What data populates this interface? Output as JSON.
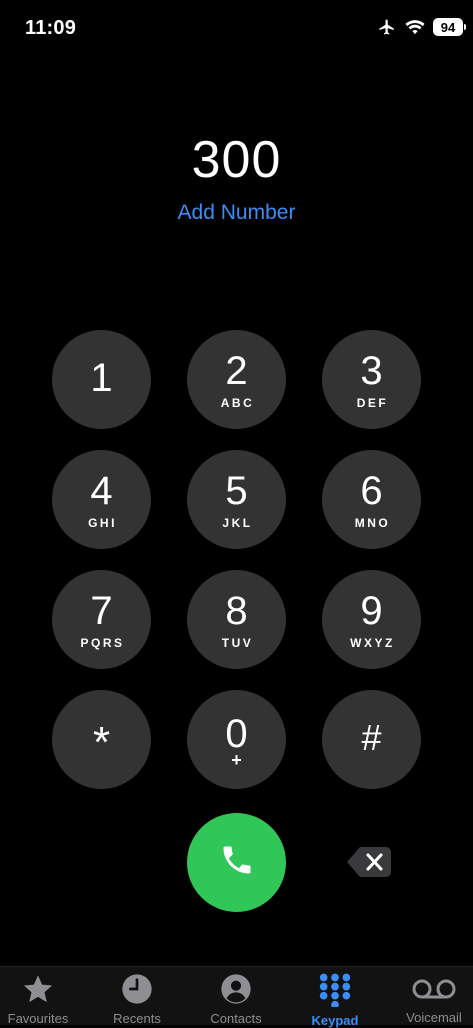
{
  "status_bar": {
    "time": "11:09",
    "battery": "94",
    "icons": [
      "airplane-icon",
      "wifi-icon",
      "battery-icon"
    ]
  },
  "dialer": {
    "number": "300",
    "add_number_label": "Add Number"
  },
  "keypad": {
    "keys": [
      {
        "digit": "1",
        "letters": ""
      },
      {
        "digit": "2",
        "letters": "ABC"
      },
      {
        "digit": "3",
        "letters": "DEF"
      },
      {
        "digit": "4",
        "letters": "GHI"
      },
      {
        "digit": "5",
        "letters": "JKL"
      },
      {
        "digit": "6",
        "letters": "MNO"
      },
      {
        "digit": "7",
        "letters": "PQRS"
      },
      {
        "digit": "8",
        "letters": "TUV"
      },
      {
        "digit": "9",
        "letters": "WXYZ"
      },
      {
        "digit": "*",
        "letters": ""
      },
      {
        "digit": "0",
        "letters": "+"
      },
      {
        "digit": "#",
        "letters": ""
      }
    ]
  },
  "actions": {
    "call_icon": "phone-icon",
    "delete_icon": "backspace-icon"
  },
  "tab_bar": {
    "tabs": [
      {
        "label": "Favourites",
        "icon": "star-icon",
        "active": false
      },
      {
        "label": "Recents",
        "icon": "clock-icon",
        "active": false
      },
      {
        "label": "Contacts",
        "icon": "person-icon",
        "active": false
      },
      {
        "label": "Keypad",
        "icon": "keypad-icon",
        "active": true
      },
      {
        "label": "Voicemail",
        "icon": "voicemail-icon",
        "active": false
      }
    ]
  },
  "colors": {
    "background": "#000000",
    "key": "#333333",
    "accent": "#3a8ef6",
    "call": "#30c758",
    "inactive": "#8e8e93"
  }
}
